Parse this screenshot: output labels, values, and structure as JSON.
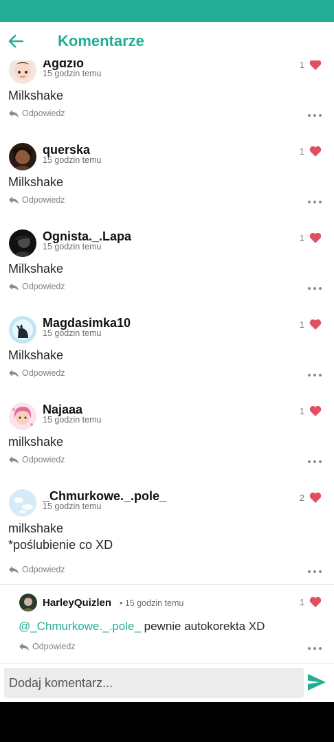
{
  "header": {
    "title": "Komentarze"
  },
  "comments": [
    {
      "user": "Agdzio",
      "time": "15 godzin temu",
      "likes": "1",
      "text": "Milkshake",
      "reply": "Odpowiedz"
    },
    {
      "user": "querska",
      "time": "15 godzin temu",
      "likes": "1",
      "text": "Milkshake",
      "reply": "Odpowiedz"
    },
    {
      "user": "Ognista._.Lapa",
      "time": "15 godzin temu",
      "likes": "1",
      "text": "Milkshake",
      "reply": "Odpowiedz"
    },
    {
      "user": "Magdasimka10",
      "time": "15 godzin temu",
      "likes": "1",
      "text": "Milkshake",
      "reply": "Odpowiedz"
    },
    {
      "user": "Najaaa",
      "time": "15 godzin temu",
      "likes": "1",
      "text": "milkshake",
      "reply": "Odpowiedz"
    },
    {
      "user": "_Chmurkowe._.pole_",
      "time": "15 godzin temu",
      "likes": "2",
      "text": "milkshake\n*poślubienie co XD",
      "reply": "Odpowiedz"
    }
  ],
  "reply": {
    "user": "HarleyQuizlen",
    "time": "• 15 godzin temu",
    "likes": "1",
    "mention": "@_Chmurkowe._.pole_",
    "text": " pewnie autokorekta XD",
    "reply": "Odpowiedz"
  },
  "input": {
    "placeholder": "Dodaj komentarz..."
  },
  "colors": {
    "accent": "#22ad94",
    "statusbar": "#21ae95",
    "heart": "#e05060"
  },
  "icons": [
    "back-arrow-icon",
    "heart-icon",
    "reply-arrow-icon",
    "more-dots-icon",
    "send-icon"
  ]
}
